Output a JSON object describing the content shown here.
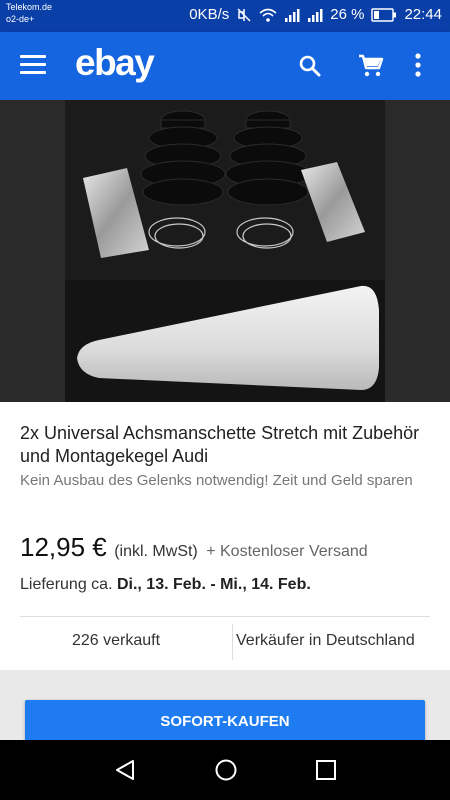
{
  "status_bar": {
    "carrier_1": "Telekom.de",
    "carrier_2": "o2-de+",
    "data_rate": "0KB/s",
    "battery": "26 %",
    "time": "22:44"
  },
  "app_bar": {
    "logo": "ebay",
    "icons": [
      "menu-icon",
      "search-icon",
      "cart-icon",
      "more-vert-icon"
    ]
  },
  "listing": {
    "title": "2x Universal Achsmanschette Stretch mit Zubehör und Montagekegel Audi",
    "subtitle": "Kein Ausbau des Gelenks notwendig! Zeit und Geld sparen",
    "price": "12,95 €",
    "vat_note": "(inkl. MwSt)",
    "shipping": "+ Kostenloser Versand",
    "delivery_label": "Lieferung ca.",
    "delivery_dates": "Di., 13. Feb. - Mi., 14. Feb.",
    "sold_count": "226 verkauft",
    "seller_location": "Verkäufer in Deutschland"
  },
  "actions": {
    "buy_now": "SOFORT-KAUFEN"
  },
  "nav_bar": {
    "icons": [
      "back-icon",
      "home-icon",
      "recent-apps-icon"
    ]
  },
  "colors": {
    "status_bar": "#0a3fa8",
    "app_bar": "#1565e0",
    "buy_button": "#1e7cf0"
  }
}
